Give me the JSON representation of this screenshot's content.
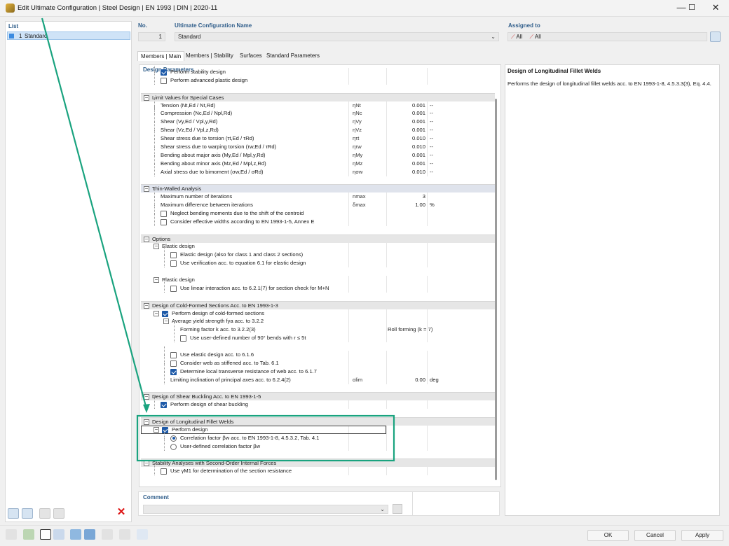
{
  "window": {
    "title": "Edit Ultimate Configuration | Steel Design | EN 1993 | DIN | 2020-11",
    "minimize": "—",
    "maximize": "☐",
    "close": "✕"
  },
  "list": {
    "header": "List",
    "items": [
      {
        "no": "1",
        "name": "Standard"
      }
    ]
  },
  "config": {
    "no_label": "No.",
    "no_value": "1",
    "name_label": "Ultimate Configuration Name",
    "name_value": "Standard",
    "assigned_label": "Assigned to",
    "assigned_members": "All",
    "assigned_sets": "All"
  },
  "tabs": [
    "Members | Main",
    "Members | Stability",
    "Surfaces",
    "Standard Parameters"
  ],
  "design_params": {
    "header": "Design Parameters",
    "rows": [
      {
        "kind": "item",
        "level": 1,
        "label": "Perform stability design",
        "check": true
      },
      {
        "kind": "item",
        "level": 1,
        "label": "Perform advanced plastic design",
        "check": false
      },
      {
        "kind": "blank"
      },
      {
        "kind": "group",
        "label": "Limit Values for Special Cases"
      },
      {
        "kind": "item",
        "level": 1,
        "label": "Tension (Nt,Ed / Nt,Rd)",
        "sym": "ηNt",
        "val": "0.001",
        "unit": "--"
      },
      {
        "kind": "item",
        "level": 1,
        "label": "Compression (Nc,Ed / Npl,Rd)",
        "sym": "ηNc",
        "val": "0.001",
        "unit": "--"
      },
      {
        "kind": "item",
        "level": 1,
        "label": "Shear (Vy,Ed / Vpl,y,Rd)",
        "sym": "ηVy",
        "val": "0.001",
        "unit": "--"
      },
      {
        "kind": "item",
        "level": 1,
        "label": "Shear (Vz,Ed / Vpl,z,Rd)",
        "sym": "ηVz",
        "val": "0.001",
        "unit": "--"
      },
      {
        "kind": "item",
        "level": 1,
        "label": "Shear stress due to torsion (τt,Ed / τRd)",
        "sym": "ητt",
        "val": "0.010",
        "unit": "--"
      },
      {
        "kind": "item",
        "level": 1,
        "label": "Shear stress due to warping torsion (τw,Ed / τRd)",
        "sym": "ητw",
        "val": "0.010",
        "unit": "--"
      },
      {
        "kind": "item",
        "level": 1,
        "label": "Bending about major axis (My,Ed / Mpl,y,Rd)",
        "sym": "ηMy",
        "val": "0.001",
        "unit": "--"
      },
      {
        "kind": "item",
        "level": 1,
        "label": "Bending about minor axis (Mz,Ed / Mpl,z,Rd)",
        "sym": "ηMz",
        "val": "0.001",
        "unit": "--"
      },
      {
        "kind": "item",
        "level": 1,
        "label": "Axial stress due to bimoment (σw,Ed / σRd)",
        "sym": "ησw",
        "val": "0.010",
        "unit": "--"
      },
      {
        "kind": "blank"
      },
      {
        "kind": "group",
        "label": "Thin-Walled Analysis",
        "sel": true
      },
      {
        "kind": "item",
        "level": 1,
        "label": "Maximum number of iterations",
        "sym": "nmax",
        "val": "3",
        "unit": ""
      },
      {
        "kind": "item",
        "level": 1,
        "label": "Maximum difference between iterations",
        "sym": "δmax",
        "val": "1.00",
        "unit": "%"
      },
      {
        "kind": "item",
        "level": 1,
        "label": "Neglect bending moments due to the shift of the centroid",
        "check": false
      },
      {
        "kind": "item",
        "level": 1,
        "label": "Consider effective widths according to EN 1993-1-5, Annex E",
        "check": false
      },
      {
        "kind": "blank"
      },
      {
        "kind": "group",
        "label": "Options"
      },
      {
        "kind": "sub",
        "level": 1,
        "label": "Elastic design"
      },
      {
        "kind": "item",
        "level": 2,
        "label": "Elastic design (also for class 1 and class 2 sections)",
        "check": false
      },
      {
        "kind": "item",
        "level": 2,
        "label": "Use verification acc. to equation 6.1 for elastic design",
        "check": false
      },
      {
        "kind": "blank"
      },
      {
        "kind": "sub",
        "level": 1,
        "label": "Plastic design"
      },
      {
        "kind": "item",
        "level": 2,
        "label": "Use linear interaction acc. to 6.2.1(7) for section check for M+N",
        "check": false
      },
      {
        "kind": "blank"
      },
      {
        "kind": "group",
        "label": "Design of Cold-Formed Sections Acc. to EN 1993-1-3"
      },
      {
        "kind": "sub",
        "level": 1,
        "label": "Perform design of cold-formed sections",
        "check": true
      },
      {
        "kind": "sub",
        "level": 2,
        "label": "Average yield strength fya acc. to 3.2.2"
      },
      {
        "kind": "item",
        "level": 3,
        "label": "Forming factor k acc. to 3.2.2(3)",
        "text": "Roll forming (k = 7)"
      },
      {
        "kind": "item",
        "level": 3,
        "label": "Use user-defined number of 90° bends with r ≤ 5t",
        "check": false
      },
      {
        "kind": "blank"
      },
      {
        "kind": "item",
        "level": 2,
        "label": "Use elastic design acc. to 6.1.6",
        "check": false
      },
      {
        "kind": "item",
        "level": 2,
        "label": "Consider web as stiffened acc. to Tab. 6.1",
        "check": false
      },
      {
        "kind": "item",
        "level": 2,
        "label": "Determine local transverse resistance of web acc. to 6.1.7",
        "check": true
      },
      {
        "kind": "item",
        "level": 2,
        "label": "Limiting inclination of principal axes acc. to 6.2.4(2)",
        "sym": "αlim",
        "val": "0.00",
        "unit": "deg"
      },
      {
        "kind": "blank"
      },
      {
        "kind": "group",
        "label": "Design of Shear Buckling Acc. to EN 1993-1-5"
      },
      {
        "kind": "item",
        "level": 1,
        "label": "Perform design of shear buckling",
        "check": true
      },
      {
        "kind": "blank"
      },
      {
        "kind": "group",
        "label": "Design of Longitudinal Fillet Welds"
      },
      {
        "kind": "sub",
        "level": 1,
        "label": "Perform design",
        "check": true,
        "outlined": true
      },
      {
        "kind": "item",
        "level": 2,
        "label": "Correlation factor βw acc. to EN 1993-1-8, 4.5.3.2, Tab. 4.1",
        "radio": true
      },
      {
        "kind": "item",
        "level": 2,
        "label": "User-defined correlation factor βw",
        "radio": false
      },
      {
        "kind": "blank"
      },
      {
        "kind": "group",
        "label": "Stability Analyses with Second-Order Internal Forces"
      },
      {
        "kind": "item",
        "level": 1,
        "label": "Use γM1 for determination of the section resistance",
        "check": false
      }
    ]
  },
  "info": {
    "title": "Design of Longitudinal Fillet Welds",
    "text": "Performs the design of longitudinal fillet welds acc. to EN 1993-1-8, 4.5.3.3(3), Eq. 4.4."
  },
  "comment": {
    "label": "Comment",
    "value": ""
  },
  "buttons": {
    "ok": "OK",
    "cancel": "Cancel",
    "apply": "Apply"
  },
  "colors": {
    "accent": "#1e5aa8",
    "highlight": "#1aa37f",
    "header_text": "#2f5d8a"
  }
}
